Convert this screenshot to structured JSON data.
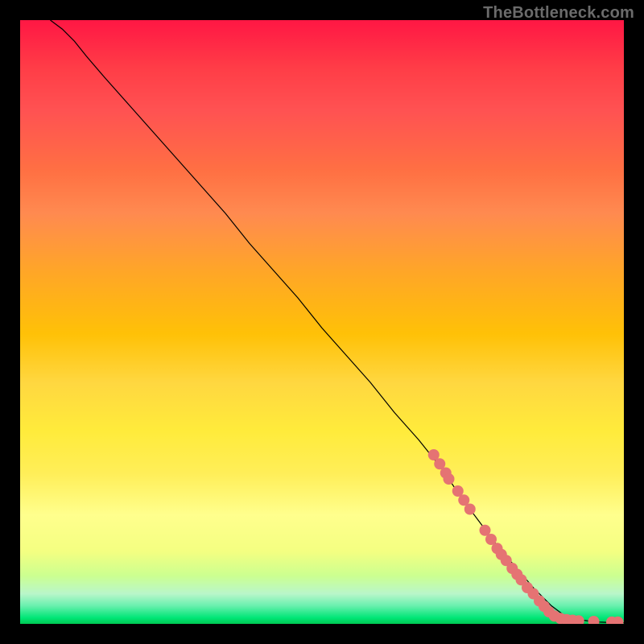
{
  "watermark": "TheBottleneck.com",
  "chart_data": {
    "type": "line",
    "title": "",
    "xlabel": "",
    "ylabel": "",
    "xlim": [
      0,
      100
    ],
    "ylim": [
      0,
      100
    ],
    "grid": false,
    "series": [
      {
        "name": "curve",
        "color": "#000000",
        "stroke_width": 1.2,
        "x": [
          5,
          7,
          9,
          11,
          14,
          18,
          22,
          26,
          30,
          34,
          38,
          42,
          46,
          50,
          54,
          58,
          62,
          66,
          70,
          73,
          76,
          79,
          82,
          85,
          88,
          90,
          92,
          94,
          96,
          98,
          100
        ],
        "y": [
          100,
          98.5,
          96.5,
          94,
          90.5,
          86,
          81.5,
          77,
          72.5,
          68,
          63,
          58.5,
          54,
          49,
          44.5,
          40,
          35,
          30.5,
          25.5,
          21,
          17,
          13,
          9.5,
          6,
          3,
          1.5,
          0.8,
          0.5,
          0.3,
          0.2,
          0.2
        ]
      }
    ],
    "scatter": {
      "name": "markers",
      "color": "#e57373",
      "radius": 7,
      "points": [
        {
          "x": 68.5,
          "y": 28.0
        },
        {
          "x": 69.5,
          "y": 26.5
        },
        {
          "x": 70.5,
          "y": 25.0
        },
        {
          "x": 71.0,
          "y": 24.0
        },
        {
          "x": 72.5,
          "y": 22.0
        },
        {
          "x": 73.5,
          "y": 20.5
        },
        {
          "x": 74.5,
          "y": 19.0
        },
        {
          "x": 77.0,
          "y": 15.5
        },
        {
          "x": 78.0,
          "y": 14.0
        },
        {
          "x": 79.0,
          "y": 12.5
        },
        {
          "x": 79.7,
          "y": 11.5
        },
        {
          "x": 80.5,
          "y": 10.5
        },
        {
          "x": 81.5,
          "y": 9.2
        },
        {
          "x": 82.3,
          "y": 8.2
        },
        {
          "x": 83.0,
          "y": 7.3
        },
        {
          "x": 84.0,
          "y": 6.0
        },
        {
          "x": 85.0,
          "y": 5.0
        },
        {
          "x": 86.0,
          "y": 3.8
        },
        {
          "x": 86.8,
          "y": 2.9
        },
        {
          "x": 87.6,
          "y": 2.0
        },
        {
          "x": 88.5,
          "y": 1.3
        },
        {
          "x": 89.5,
          "y": 0.9
        },
        {
          "x": 90.5,
          "y": 0.7
        },
        {
          "x": 91.5,
          "y": 0.6
        },
        {
          "x": 92.5,
          "y": 0.5
        },
        {
          "x": 95.0,
          "y": 0.4
        },
        {
          "x": 98.0,
          "y": 0.3
        },
        {
          "x": 99.0,
          "y": 0.3
        }
      ]
    }
  }
}
